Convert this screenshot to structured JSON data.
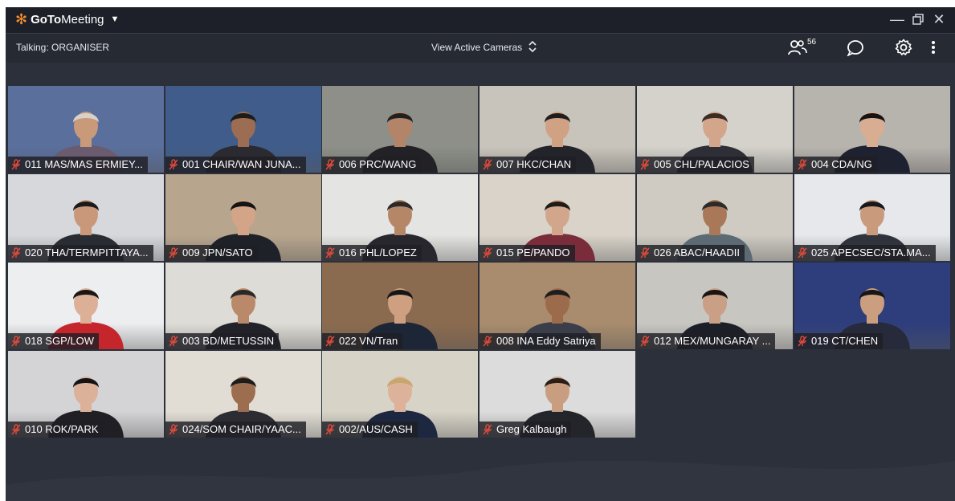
{
  "app": {
    "brand_bold": "GoTo",
    "brand_light": "Meeting"
  },
  "toolbar": {
    "talking": "Talking: ORGANISER",
    "view_mode": "View Active Cameras",
    "attendee_count": "56"
  },
  "tiles": [
    {
      "label": "011 MAS/MAS ERMIEY...",
      "bg": "#5a6f9c",
      "shirt": "#6a5b6e",
      "skin": "#c99a7a",
      "hair": "#d8d2cc"
    },
    {
      "label": "001 CHAIR/WAN JUNA...",
      "bg": "#3f5c8a",
      "shirt": "#2a2a30",
      "skin": "#9c6d52",
      "hair": "#1c1c1c"
    },
    {
      "label": "006 PRC/WANG",
      "bg": "#8d8f88",
      "shirt": "#222226",
      "skin": "#b38467",
      "hair": "#202020"
    },
    {
      "label": "007 HKC/CHAN",
      "bg": "#c9c4bb",
      "shirt": "#23232a",
      "skin": "#d1a184",
      "hair": "#1e1e1e"
    },
    {
      "label": "005 CHL/PALACIOS",
      "bg": "#d5d2cb",
      "shirt": "#2e2f36",
      "skin": "#d3a58a",
      "hair": "#3b2d24"
    },
    {
      "label": "004 CDA/NG",
      "bg": "#b7b3ad",
      "shirt": "#1e2230",
      "skin": "#d8ad91",
      "hair": "#141414"
    },
    {
      "label": "020 THA/TERMPITTAYA...",
      "bg": "#d6d8dc",
      "shirt": "#2a2c34",
      "skin": "#c9987a",
      "hair": "#1a1a1a"
    },
    {
      "label": "009 JPN/SATO",
      "bg": "#b8a58e",
      "shirt": "#1e2128",
      "skin": "#d3a487",
      "hair": "#141414"
    },
    {
      "label": "016 PHL/LOPEZ",
      "bg": "#e4e4e2",
      "shirt": "#27272d",
      "skin": "#b58767",
      "hair": "#2a2a2a"
    },
    {
      "label": "015 PE/PANDO",
      "bg": "#d9d3c9",
      "shirt": "#7a2c3a",
      "skin": "#d2a68b",
      "hair": "#1f1b19"
    },
    {
      "label": "026 ABAC/HAADII",
      "bg": "#cfcbc3",
      "shirt": "#5c6a73",
      "skin": "#a97858",
      "hair": "#2c2a2a"
    },
    {
      "label": "025 APECSEC/STA.MA...",
      "bg": "#e6e8ec",
      "shirt": "#30333b",
      "skin": "#c99a7c",
      "hair": "#181818"
    },
    {
      "label": "018 SGP/LOW",
      "bg": "#eceef0",
      "shirt": "#c5262c",
      "skin": "#dcb097",
      "hair": "#1b1515"
    },
    {
      "label": "003 BD/METUSSIN",
      "bg": "#dedcd6",
      "shirt": "#222329",
      "skin": "#b9896a",
      "hair": "#292929"
    },
    {
      "label": "022 VN/Tran",
      "bg": "#8b6b4f",
      "shirt": "#1d2636",
      "skin": "#cf9f82",
      "hair": "#151515"
    },
    {
      "label": "008 INA Eddy Satriya",
      "bg": "#a88c6d",
      "shirt": "#3a3d4a",
      "skin": "#9c6b4c",
      "hair": "#1d1d1d"
    },
    {
      "label": "012 MEX/MUNGARAY ...",
      "bg": "#c8c6c1",
      "shirt": "#1d1f28",
      "skin": "#c99f86",
      "hair": "#1a1412"
    },
    {
      "label": "019 CT/CHEN",
      "bg": "#2e3e7c",
      "shirt": "#262a3a",
      "skin": "#cc9e80",
      "hair": "#161616"
    },
    {
      "label": "010 ROK/PARK",
      "bg": "#d4d4d6",
      "shirt": "#1f1f24",
      "skin": "#dbb19a",
      "hair": "#141414"
    },
    {
      "label": "024/SOM CHAIR/YAAC...",
      "bg": "#e1ddd4",
      "shirt": "#2c2c32",
      "skin": "#9d6d4f",
      "hair": "#1c1c1c"
    },
    {
      "label": "002/AUS/CASH",
      "bg": "#d7d3c7",
      "shirt": "#1d2740",
      "skin": "#dcb39a",
      "hair": "#c9a66b"
    },
    {
      "label": "Greg Kalbaugh",
      "bg": "#dcdcdc",
      "shirt": "#23252b",
      "skin": "#c99d80",
      "hair": "#2b1e16"
    }
  ]
}
